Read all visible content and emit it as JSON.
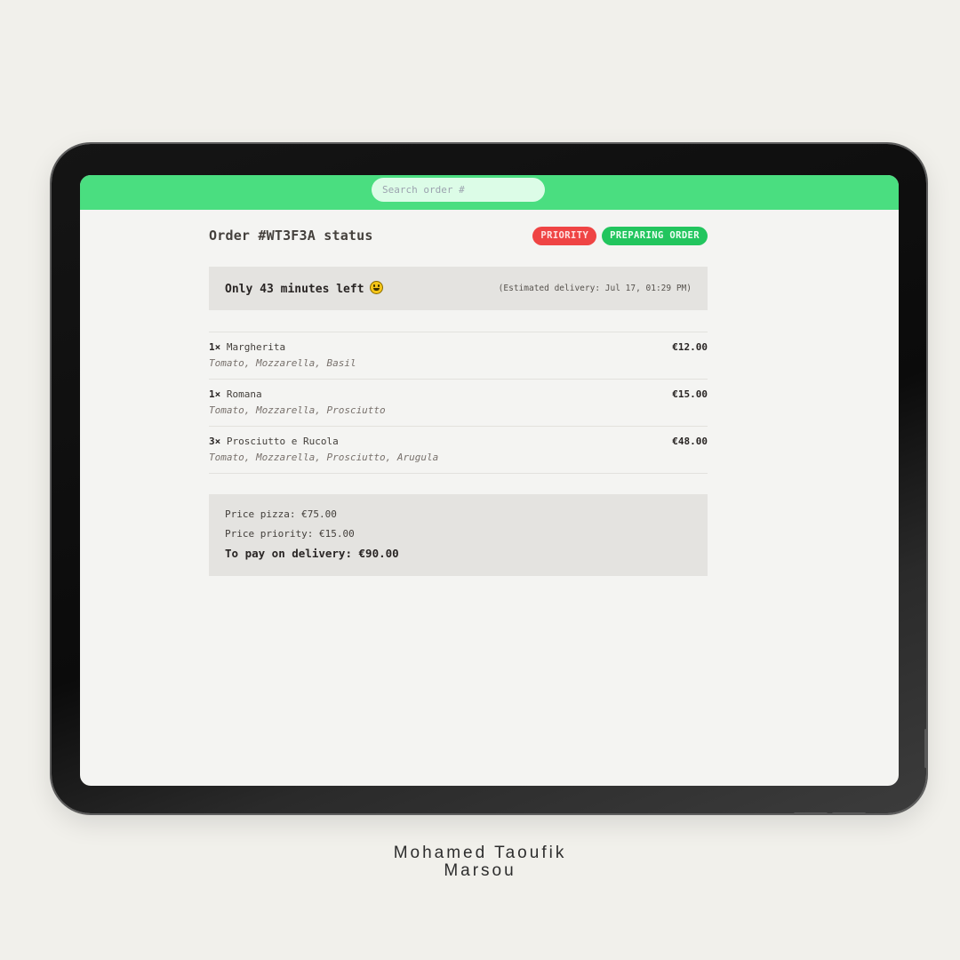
{
  "search": {
    "placeholder": "Search order #"
  },
  "order": {
    "title": "Order #WT3F3A status",
    "badges": {
      "priority": "PRIORITY",
      "status": "PREPARING ORDER"
    },
    "eta_message": "Only 43 minutes left",
    "estimated_delivery": "(Estimated delivery: Jul 17, 01:29 PM)"
  },
  "items": [
    {
      "qty": "1×",
      "name": "Margherita",
      "ingredients": "Tomato, Mozzarella, Basil",
      "price": "€12.00"
    },
    {
      "qty": "1×",
      "name": "Romana",
      "ingredients": "Tomato, Mozzarella, Prosciutto",
      "price": "€15.00"
    },
    {
      "qty": "3×",
      "name": "Prosciutto e Rucola",
      "ingredients": "Tomato, Mozzarella, Prosciutto, Arugula",
      "price": "€48.00"
    }
  ],
  "summary": {
    "price_pizza": "Price pizza: €75.00",
    "price_priority": "Price priority: €15.00",
    "to_pay": "To pay on delivery: €90.00"
  },
  "credit": {
    "line1": "Mohamed Taoufik",
    "line2": "Marsou"
  },
  "colors": {
    "topbar": "#4ade80",
    "priority_badge": "#ef4444",
    "status_badge": "#22c55e"
  },
  "icons": {
    "eta_emoji": "grinning-face-icon"
  }
}
